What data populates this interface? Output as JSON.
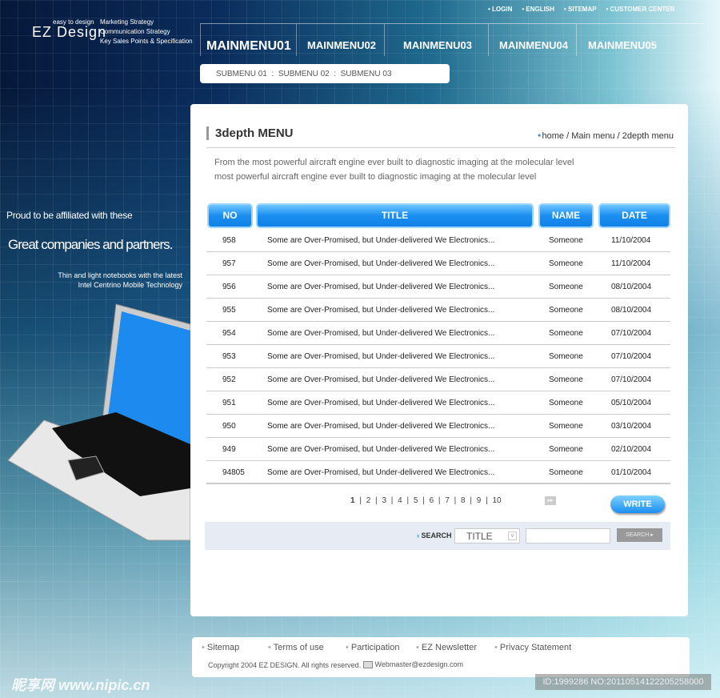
{
  "logo": {
    "text": "EZ Design",
    "tagline": "easy to design"
  },
  "header_tags": [
    "Marketing Strategy",
    "Communication Strategy",
    "Key Sales Points & Specification"
  ],
  "top_nav": [
    "LOGIN",
    "ENGLISH",
    "SITEMAP",
    "CUSTOMER CENTER"
  ],
  "main_menu": [
    "MAINMENU01",
    "MAINMENU02",
    "MAINMENU03",
    "MAINMENU04",
    "MAINMENU05"
  ],
  "sub_menu": [
    "SUBMENU 01",
    "SUBMENU 02",
    "SUBMENU 03"
  ],
  "promo": {
    "line1": "Proud to be affiliated with these",
    "line2": "Great companies and partners.",
    "line3": "Thin and light notebooks with the latest",
    "line4": "Intel Centrino Mobile Technology"
  },
  "page": {
    "title": "3depth MENU",
    "breadcrumb": "home / Main menu / 2depth menu",
    "desc1": "From the most powerful aircraft engine ever built to diagnostic imaging at the molecular level",
    "desc2": "most powerful aircraft engine ever built to diagnostic imaging at the molecular level"
  },
  "table": {
    "headers": [
      "NO",
      "TITLE",
      "NAME",
      "DATE"
    ],
    "rows": [
      [
        "958",
        "Some are Over-Promised, but Under-delivered We Electronics...",
        "Someone",
        "11/10/2004"
      ],
      [
        "957",
        "Some are Over-Promised, but Under-delivered We Electronics...",
        "Someone",
        "11/10/2004"
      ],
      [
        "956",
        "Some are Over-Promised, but Under-delivered We Electronics...",
        "Someone",
        "08/10/2004"
      ],
      [
        "955",
        "Some are Over-Promised, but Under-delivered We Electronics...",
        "Someone",
        "08/10/2004"
      ],
      [
        "954",
        "Some are Over-Promised, but Under-delivered We Electronics...",
        "Someone",
        "07/10/2004"
      ],
      [
        "953",
        "Some are Over-Promised, but Under-delivered We Electronics...",
        "Someone",
        "07/10/2004"
      ],
      [
        "952",
        "Some are Over-Promised, but Under-delivered We Electronics...",
        "Someone",
        "07/10/2004"
      ],
      [
        "951",
        "Some are Over-Promised, but Under-delivered We Electronics...",
        "Someone",
        "05/10/2004"
      ],
      [
        "950",
        "Some are Over-Promised, but Under-delivered We Electronics...",
        "Someone",
        "03/10/2004"
      ],
      [
        "949",
        "Some are Over-Promised, but Under-delivered We Electronics...",
        "Someone",
        "02/10/2004"
      ],
      [
        "94805",
        "Some are Over-Promised, but Under-delivered We Electronics...",
        "Someone",
        "01/10/2004"
      ]
    ]
  },
  "pagination": {
    "pages": [
      "1",
      "2",
      "3",
      "4",
      "5",
      "6",
      "7",
      "8",
      "9",
      "10"
    ],
    "current": "1"
  },
  "write_label": "WRITE",
  "search": {
    "label": "SEARCH",
    "select_value": "TITLE",
    "input_value": "",
    "button": "SEARCH ▸"
  },
  "footer": {
    "links": [
      "Sitemap",
      "Terms of use",
      "Participation",
      "EZ Newsletter",
      "Privacy Statement"
    ],
    "copyright": "Copyright 2004 EZ DESIGN. All rights reserved.",
    "email": "Webmaster@ezdesign.com"
  },
  "watermark": {
    "site": "昵享网 www.nipic.cn",
    "id": "ID:1999286 NO:20110514122205258000"
  },
  "colors": {
    "accent": "#1a8ef0",
    "bg_dark": "#06183a"
  }
}
